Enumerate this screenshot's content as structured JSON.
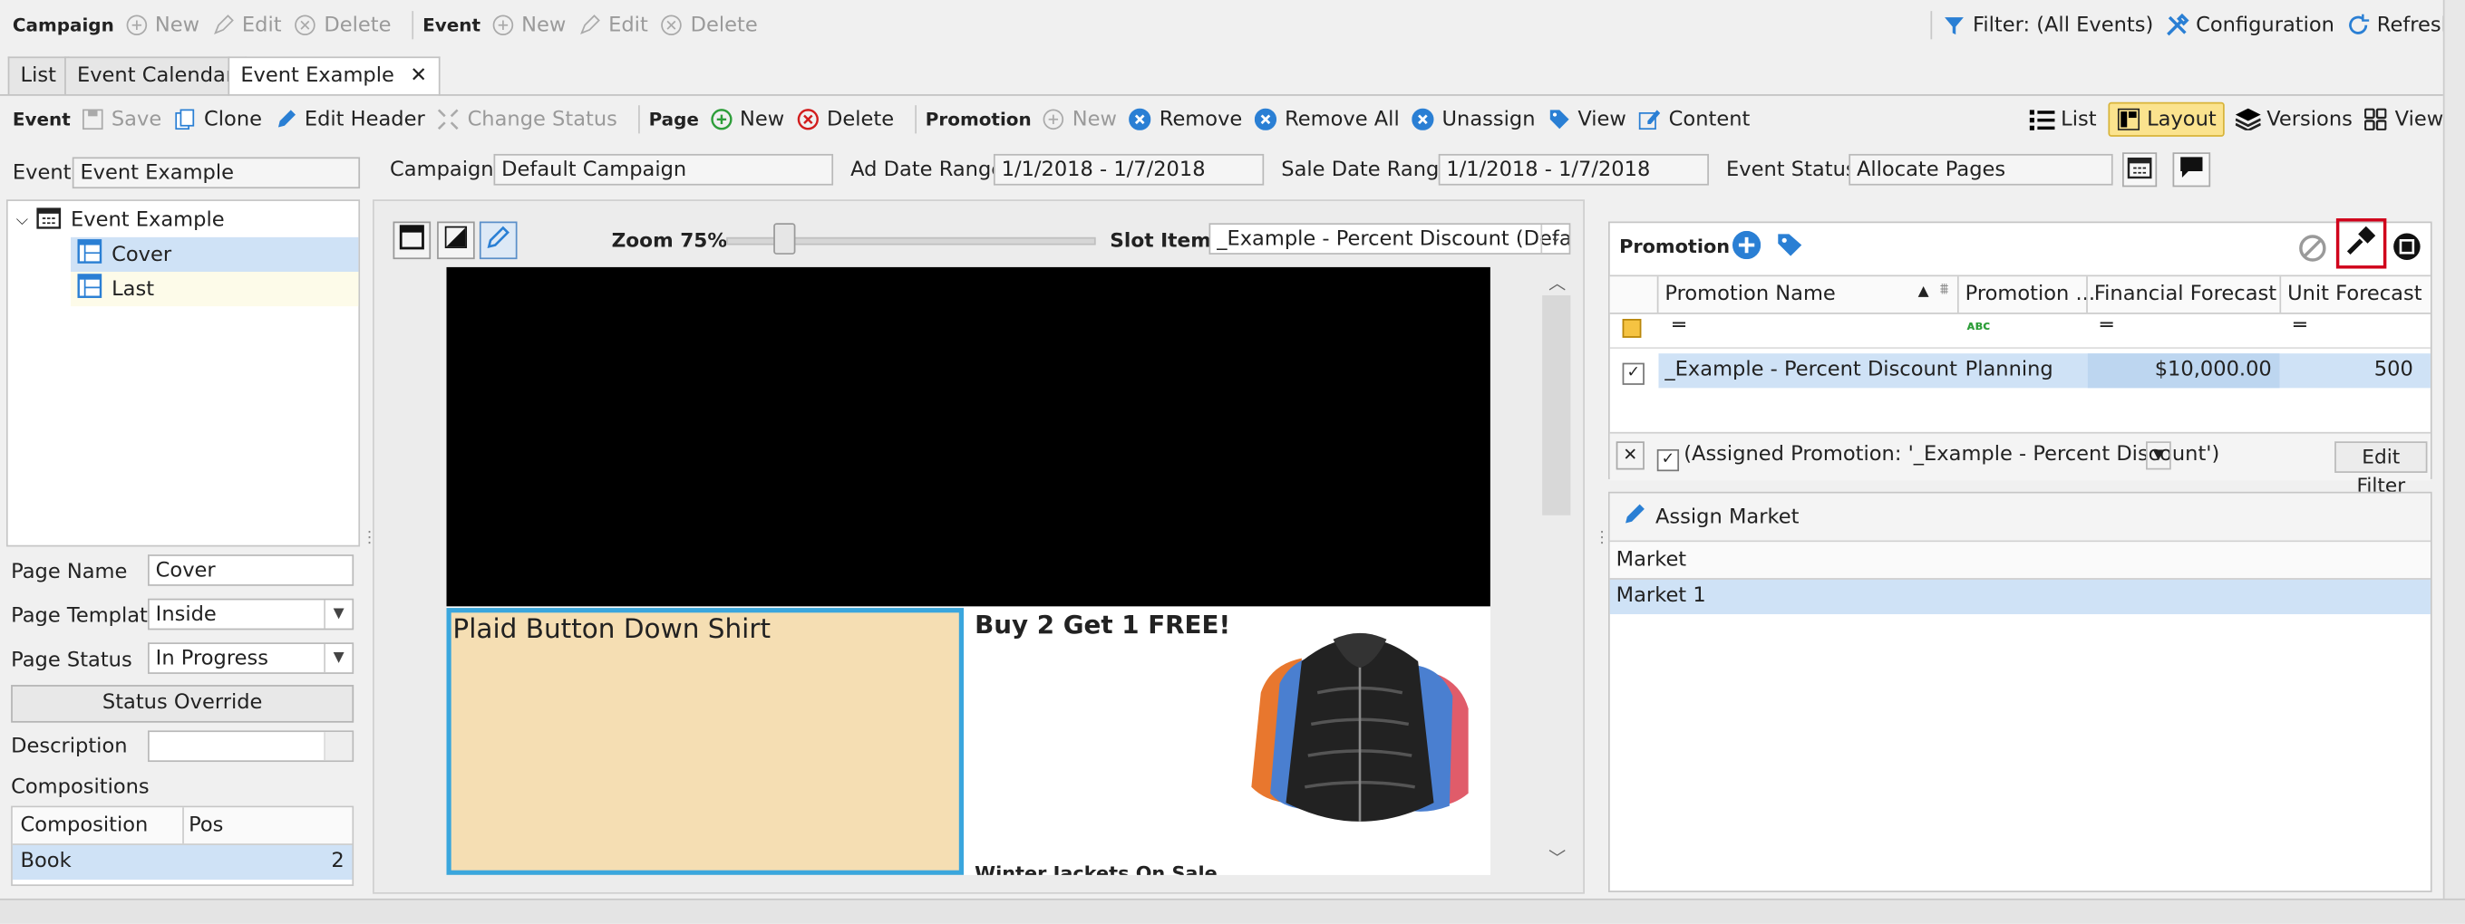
{
  "top_toolbar": {
    "campaign_group": "Campaign",
    "campaign_new": "New",
    "campaign_edit": "Edit",
    "campaign_delete": "Delete",
    "event_group": "Event",
    "event_new": "New",
    "event_edit": "Edit",
    "event_delete": "Delete",
    "filter": "Filter: (All Events)",
    "configuration": "Configuration",
    "refresh": "Refresh"
  },
  "tabs": [
    {
      "label": "List"
    },
    {
      "label": "Event Calendar"
    },
    {
      "label": "Event Example"
    }
  ],
  "second_toolbar": {
    "event_group": "Event",
    "save": "Save",
    "clone": "Clone",
    "edit_header": "Edit Header",
    "change_status": "Change Status",
    "page_group": "Page",
    "page_new": "New",
    "page_delete": "Delete",
    "promotion_group": "Promotion",
    "promo_new": "New",
    "remove": "Remove",
    "remove_all": "Remove All",
    "unassign": "Unassign",
    "view": "View",
    "content": "Content",
    "list": "List",
    "layout": "Layout",
    "versions": "Versions",
    "views": "Views"
  },
  "header_fields": {
    "event_label": "Event",
    "event_value": "Event Example",
    "campaign_label": "Campaign",
    "campaign_value": "Default Campaign",
    "ad_date_label": "Ad Date Range",
    "ad_date_value": "1/1/2018 - 1/7/2018",
    "sale_date_label": "Sale Date Range",
    "sale_date_value": "1/1/2018 - 1/7/2018",
    "status_label": "Event Status",
    "status_value": "Allocate Pages"
  },
  "tree": {
    "root": "Event Example",
    "children": [
      "Cover",
      "Last"
    ]
  },
  "page_props": {
    "page_name_label": "Page Name",
    "page_name_value": "Cover",
    "template_label": "Page Template",
    "template_value": "Inside",
    "status_label": "Page Status",
    "status_value": "In Progress",
    "status_override": "Status Override",
    "description_label": "Description",
    "compositions_label": "Compositions",
    "comp_headers": [
      "Composition",
      "Pos"
    ],
    "comp_rows": [
      {
        "composition": "Book",
        "pos": "2"
      }
    ]
  },
  "canvas": {
    "zoom_label": "Zoom 75%",
    "zoom_level_percent": 75,
    "slot_item_label": "Slot Item",
    "slot_item_value": "_Example - Percent Discount (Defau",
    "slot_left_title": "Plaid Button Down Shirt",
    "slot_right_title": "Buy 2 Get 1 FREE!",
    "slot_right_caption": "Winter Jackets On Sale"
  },
  "promotion_panel": {
    "title": "Promotion",
    "headers": [
      "Promotion Name",
      "Promotion ...",
      "Financial Forecast",
      "Unit Forecast"
    ],
    "rows": [
      {
        "name": "_Example - Percent Discount",
        "status": "Planning",
        "financial": "$10,000.00",
        "units": "500"
      }
    ],
    "filter_text": "(Assigned Promotion: '_Example - Percent Discount')",
    "edit_filter": "Edit Filter"
  },
  "market_panel": {
    "assign_market": "Assign Market",
    "header": "Market",
    "rows": [
      "Market 1"
    ]
  },
  "colors": {
    "selection": "#cfe2f6",
    "highlight_border": "#d0021b",
    "slot_fill": "#f5deb3",
    "slot_border": "#3aa6dd",
    "layout_active": "#fbe38e"
  }
}
